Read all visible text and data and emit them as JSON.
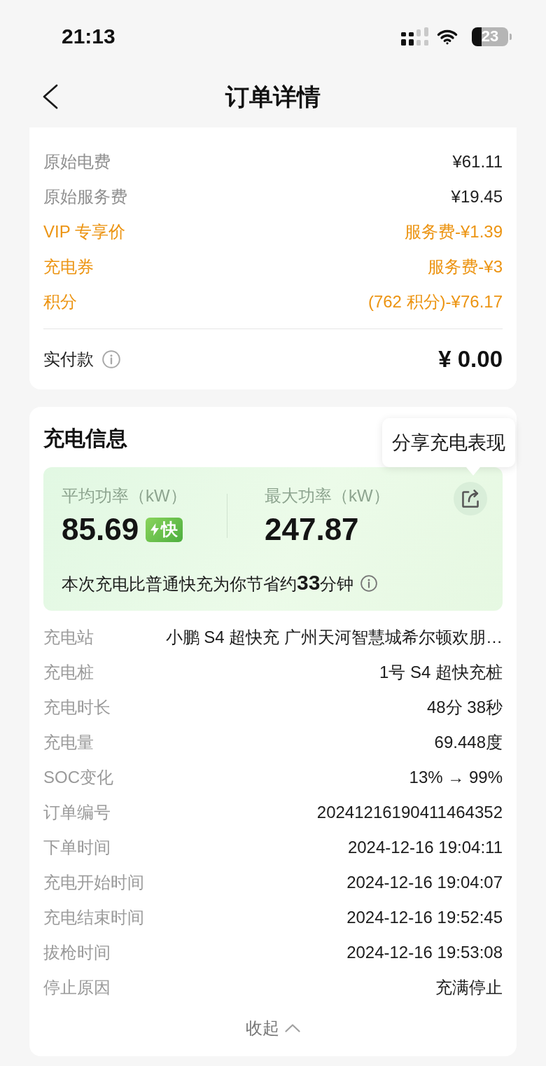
{
  "status_bar": {
    "time": "21:13",
    "battery": "23"
  },
  "header": {
    "title": "订单详情"
  },
  "fee_summary": {
    "rows": [
      {
        "label": "原始电费",
        "value": "¥61.11",
        "kind": "base"
      },
      {
        "label": "原始服务费",
        "value": "¥19.45",
        "kind": "base"
      },
      {
        "label": "VIP 专享价",
        "value": "服务费-¥1.39",
        "kind": "discount"
      },
      {
        "label": "充电券",
        "value": "服务费-¥3",
        "kind": "discount"
      },
      {
        "label": "积分",
        "value": "(762 积分)-¥76.17",
        "kind": "discount"
      }
    ],
    "total": {
      "label": "实付款",
      "value": "¥ 0.00"
    }
  },
  "charging_info": {
    "title": "充电信息",
    "tooltip": "分享充电表现",
    "power": [
      {
        "label": "平均功率（kW）",
        "value": "85.69",
        "badge": "快"
      },
      {
        "label": "最大功率（kW）",
        "value": "247.87"
      }
    ],
    "savings_note": "本次充电比普通快充为你节省约**33**分钟",
    "details": [
      {
        "label": "充电站",
        "value": "小鹏 S4 超快充 广州天河智慧城希尔顿欢朋…"
      },
      {
        "label": "充电桩",
        "value": "1号 S4 超快充桩"
      },
      {
        "label": "充电时长",
        "value": "48分 38秒"
      },
      {
        "label": "充电量",
        "value": "69.448度"
      },
      {
        "label": "SOC变化",
        "value": "13% → 99%"
      },
      {
        "label": "订单编号",
        "value": "20241216190411464352"
      },
      {
        "label": "下单时间",
        "value": "2024-12-16 19:04:11"
      },
      {
        "label": "充电开始时间",
        "value": "2024-12-16 19:04:07"
      },
      {
        "label": "充电结束时间",
        "value": "2024-12-16 19:52:45"
      },
      {
        "label": "拔枪时间",
        "value": "2024-12-16 19:53:08"
      },
      {
        "label": "停止原因",
        "value": "充满停止"
      }
    ],
    "collapse_label": "收起"
  }
}
